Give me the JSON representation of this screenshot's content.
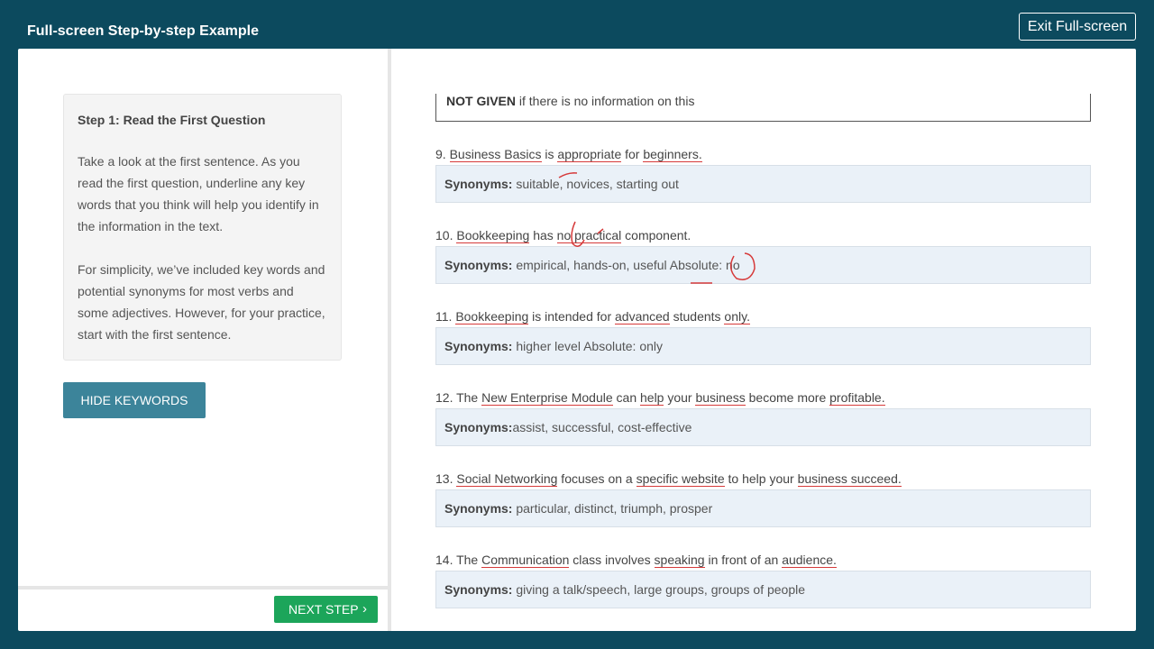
{
  "header": {
    "title": "Full-screen Step-by-step Example",
    "exit_label": "Exit Full-screen"
  },
  "left": {
    "step_title": "Step 1: Read the First Question",
    "para1": "Take a look at the first sentence. As you read the first question, underline any key words that you think will help you identify in the information in the text.",
    "para2": "For simplicity, we’ve included key words and potential synonyms for most verbs and some adjectives. However, for your practice, start with the first sentence.",
    "hide_label": "HIDE KEYWORDS",
    "next_label": "NEXT STEP",
    "next_chevron": "›"
  },
  "right": {
    "top_box_bold": "NOT GIVEN",
    "top_box_text": " if there is no information on this",
    "synonyms_label": "Synonyms:",
    "questions": [
      {
        "parts": [
          "9. ",
          "Business Basics",
          " is ",
          "appropriate",
          " for ",
          "beginners."
        ],
        "synonyms": " suitable, novices, starting out"
      },
      {
        "parts": [
          "10. ",
          "Bookkeeping",
          " has ",
          "no practical",
          " component."
        ],
        "synonyms": " empirical, hands-on, useful Absolute: no"
      },
      {
        "parts": [
          "11. ",
          "Bookkeeping",
          " is intended for ",
          "advanced",
          " students ",
          "only."
        ],
        "synonyms": " higher level Absolute: only"
      },
      {
        "parts": [
          "12. The ",
          "New Enterprise Module",
          " can ",
          "help",
          " your ",
          "business",
          " become more ",
          "profitable."
        ],
        "synonyms": "assist, successful, cost-effective"
      },
      {
        "parts": [
          "13. ",
          "Social Networking",
          " focuses on a ",
          "specific website",
          " to help your ",
          "business succeed."
        ],
        "synonyms": " particular, distinct, triumph, prosper"
      },
      {
        "parts": [
          "14. The ",
          "Communication",
          " class involves ",
          "speaking",
          " in front of an ",
          "audience."
        ],
        "synonyms": " giving a talk/speech, large groups, groups of people"
      }
    ]
  },
  "colors": {
    "background": "#0c4a5e",
    "hide_button": "#3c849a",
    "next_button": "#1ca55a",
    "annotation": "#d63a3a",
    "synonym_box": "#eaf1f8"
  }
}
